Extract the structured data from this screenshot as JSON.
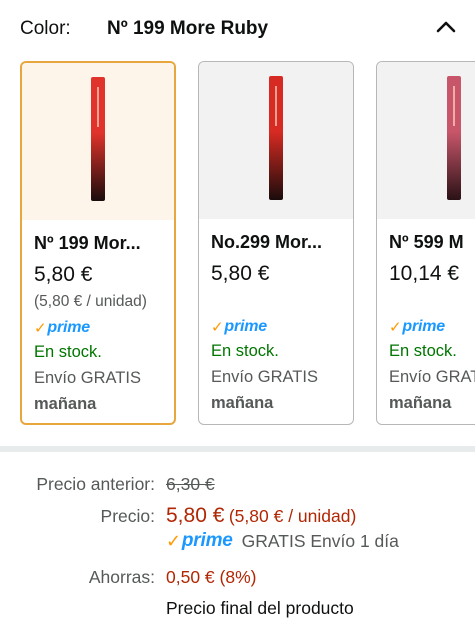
{
  "color_selector": {
    "label": "Color:",
    "selected": "Nº 199 More Ruby",
    "collapse_icon": "chevron-up-icon"
  },
  "swatches": [
    {
      "name": "Nº 199 Mor...",
      "price": "5,80 €",
      "unit_price": "(5,80 € / unidad)",
      "prime": "prime",
      "stock": "En stock.",
      "shipping": "Envío GRATIS",
      "delivery": "mañana",
      "selected": true,
      "tube_color_top": "#e0332b",
      "tube_color_bottom": "#1a0c0c"
    },
    {
      "name": "No.299 Mor...",
      "price": "5,80 €",
      "unit_price": "",
      "prime": "prime",
      "stock": "En stock.",
      "shipping": "Envío GRATIS",
      "delivery": "mañana",
      "selected": false,
      "tube_color_top": "#d62a22",
      "tube_color_bottom": "#1a0c0c"
    },
    {
      "name": "Nº 599 M",
      "price": "10,14 €",
      "unit_price": "",
      "prime": "prime",
      "stock": "En stock.",
      "shipping": "Envío GRAT",
      "delivery": "mañana",
      "selected": false,
      "tube_color_top": "#c7566a",
      "tube_color_bottom": "#2a1216"
    }
  ],
  "pricing": {
    "previous_label": "Precio anterior:",
    "previous_value": "6,30 €",
    "price_label": "Precio:",
    "price_value": "5,80 €",
    "price_unit": "(5,80 € / unidad)",
    "prime": "prime",
    "prime_shipping": "GRATIS Envío 1 día",
    "savings_label": "Ahorras:",
    "savings_value": "0,50 € (8%)",
    "final_note": "Precio final del producto"
  },
  "colors": {
    "price_red": "#b12704",
    "in_stock_green": "#007600",
    "prime_blue": "#1a98ff",
    "prime_check_orange": "#ff9900",
    "selected_border": "#e7a73e",
    "selected_bg": "#fef5ea"
  }
}
